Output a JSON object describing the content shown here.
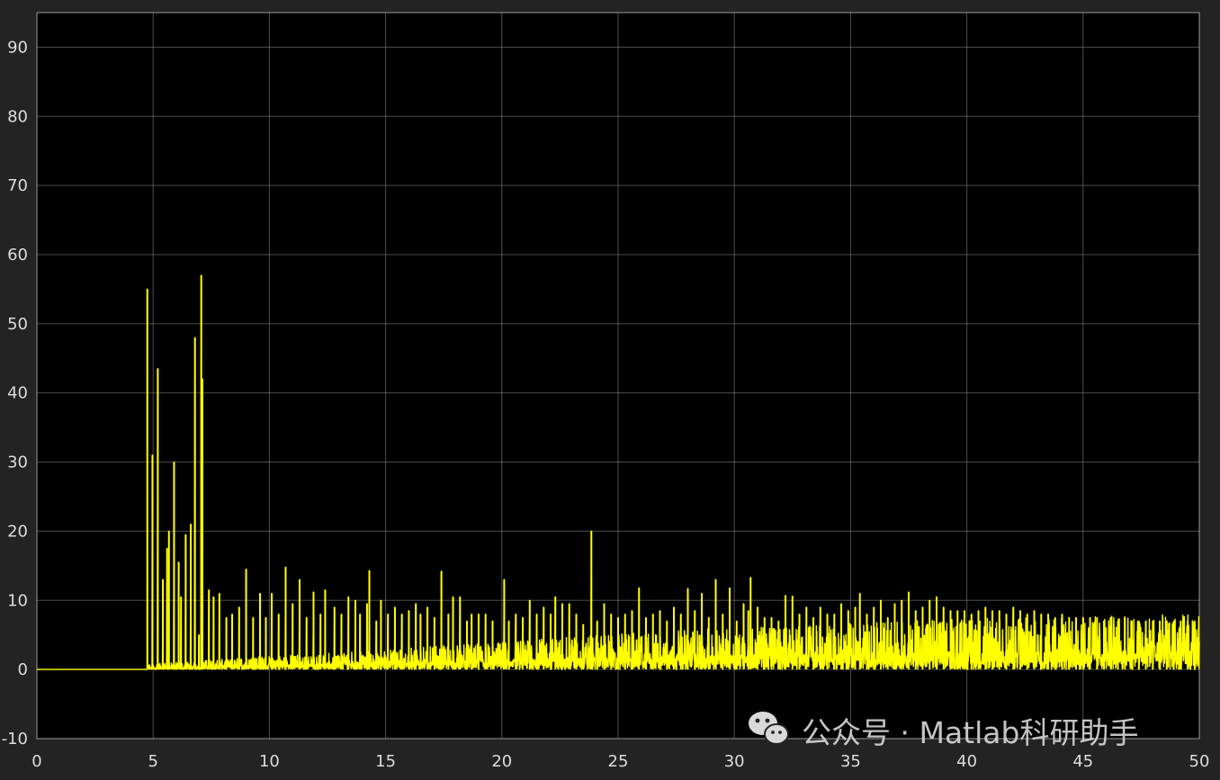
{
  "chart_data": {
    "type": "line",
    "title": "",
    "xlabel": "",
    "ylabel": "",
    "xlim": [
      0,
      50
    ],
    "ylim": [
      -10,
      95
    ],
    "x_ticks": [
      0,
      5,
      10,
      15,
      20,
      25,
      30,
      35,
      40,
      45,
      50
    ],
    "y_ticks": [
      -10,
      0,
      10,
      20,
      30,
      40,
      50,
      60,
      70,
      80,
      90
    ],
    "x_tick_labels": [
      "0",
      "5",
      "10",
      "15",
      "20",
      "25",
      "30",
      "35",
      "40",
      "45",
      "50"
    ],
    "y_tick_labels": [
      "-10",
      "0",
      "10",
      "20",
      "30",
      "40",
      "50",
      "60",
      "70",
      "80",
      "90"
    ],
    "grid": true,
    "background_color": "#000000",
    "figure_color": "#232323",
    "line_color": "#ffff00",
    "zero_before_x": 4.75,
    "peaks": [
      [
        4.75,
        55
      ],
      [
        4.97,
        31
      ],
      [
        5.2,
        43.5
      ],
      [
        5.42,
        13
      ],
      [
        5.6,
        17.5
      ],
      [
        5.68,
        20
      ],
      [
        5.9,
        30
      ],
      [
        6.1,
        15.5
      ],
      [
        6.2,
        10.5
      ],
      [
        6.4,
        19.5
      ],
      [
        6.62,
        21
      ],
      [
        6.8,
        48
      ],
      [
        6.97,
        5
      ],
      [
        7.07,
        57
      ],
      [
        7.12,
        42
      ],
      [
        7.4,
        11.5
      ],
      [
        7.6,
        10.5
      ],
      [
        7.85,
        11
      ],
      [
        8.15,
        7.5
      ],
      [
        8.4,
        8
      ],
      [
        8.7,
        9
      ],
      [
        9.0,
        14.5
      ],
      [
        9.3,
        7.5
      ],
      [
        9.6,
        11
      ],
      [
        9.85,
        7.5
      ],
      [
        10.1,
        11
      ],
      [
        10.4,
        8
      ],
      [
        10.7,
        14.8
      ],
      [
        11.0,
        9.5
      ],
      [
        11.3,
        13
      ],
      [
        11.6,
        7.5
      ],
      [
        11.9,
        11.2
      ],
      [
        12.2,
        8
      ],
      [
        12.4,
        11.5
      ],
      [
        12.8,
        9
      ],
      [
        13.1,
        8
      ],
      [
        13.4,
        10.5
      ],
      [
        13.7,
        10
      ],
      [
        13.9,
        8
      ],
      [
        14.2,
        9.5
      ],
      [
        14.3,
        14.3
      ],
      [
        14.6,
        7
      ],
      [
        14.8,
        10
      ],
      [
        15.1,
        8
      ],
      [
        15.4,
        9
      ],
      [
        15.7,
        8
      ],
      [
        16.0,
        8.5
      ],
      [
        16.3,
        9.5
      ],
      [
        16.5,
        8
      ],
      [
        16.8,
        9
      ],
      [
        17.1,
        7.5
      ],
      [
        17.4,
        14.2
      ],
      [
        17.7,
        8
      ],
      [
        17.9,
        10.5
      ],
      [
        18.2,
        10.5
      ],
      [
        18.5,
        7
      ],
      [
        18.7,
        8
      ],
      [
        19.0,
        8
      ],
      [
        19.3,
        8
      ],
      [
        19.6,
        7
      ],
      [
        20.1,
        13
      ],
      [
        20.3,
        7
      ],
      [
        20.6,
        8
      ],
      [
        20.9,
        7.5
      ],
      [
        21.2,
        10
      ],
      [
        21.5,
        8
      ],
      [
        21.8,
        9
      ],
      [
        22.1,
        8
      ],
      [
        22.3,
        10.5
      ],
      [
        22.6,
        9.5
      ],
      [
        22.9,
        9.5
      ],
      [
        23.2,
        8
      ],
      [
        23.5,
        6.5
      ],
      [
        23.85,
        20
      ],
      [
        24.1,
        7
      ],
      [
        24.4,
        9.5
      ],
      [
        24.7,
        8
      ],
      [
        25.0,
        7.5
      ],
      [
        25.3,
        8
      ],
      [
        25.6,
        8.5
      ],
      [
        25.9,
        11.8
      ],
      [
        26.2,
        7.5
      ],
      [
        26.5,
        8
      ],
      [
        26.8,
        8.5
      ],
      [
        27.1,
        7
      ],
      [
        27.4,
        9
      ],
      [
        27.7,
        8
      ],
      [
        28.0,
        11.7
      ],
      [
        28.3,
        8.5
      ],
      [
        28.6,
        11
      ],
      [
        28.9,
        7.5
      ],
      [
        29.2,
        13
      ],
      [
        29.5,
        8
      ],
      [
        29.8,
        11.8
      ],
      [
        30.1,
        7
      ],
      [
        30.4,
        9.5
      ],
      [
        30.6,
        8.5
      ],
      [
        30.7,
        13.3
      ],
      [
        31.0,
        9
      ],
      [
        31.3,
        7.5
      ],
      [
        31.6,
        7.5
      ],
      [
        31.9,
        7
      ],
      [
        32.2,
        10.7
      ],
      [
        32.5,
        10.6
      ],
      [
        32.8,
        8
      ],
      [
        33.1,
        9
      ],
      [
        33.4,
        7.5
      ],
      [
        33.7,
        9
      ],
      [
        34.0,
        8
      ],
      [
        34.3,
        8
      ],
      [
        34.6,
        9.5
      ],
      [
        34.9,
        8.5
      ],
      [
        35.2,
        9
      ],
      [
        35.4,
        11
      ],
      [
        35.7,
        8
      ],
      [
        36.0,
        9
      ],
      [
        36.3,
        10
      ],
      [
        36.6,
        7.5
      ],
      [
        36.9,
        9.5
      ],
      [
        37.2,
        10
      ],
      [
        37.5,
        11.2
      ],
      [
        37.8,
        8.5
      ],
      [
        38.1,
        9
      ],
      [
        38.4,
        10
      ],
      [
        38.7,
        10.5
      ],
      [
        39.0,
        9
      ],
      [
        39.3,
        8.5
      ],
      [
        39.6,
        8.5
      ],
      [
        39.9,
        8.5
      ],
      [
        40.2,
        8
      ],
      [
        40.5,
        8.5
      ],
      [
        40.8,
        9
      ],
      [
        41.1,
        8.5
      ],
      [
        41.4,
        8.5
      ],
      [
        41.7,
        8
      ],
      [
        42.0,
        9
      ],
      [
        42.3,
        8.5
      ],
      [
        42.6,
        8
      ],
      [
        42.9,
        8.5
      ],
      [
        43.2,
        8
      ],
      [
        43.5,
        8
      ],
      [
        43.8,
        7.5
      ],
      [
        44.1,
        8
      ],
      [
        44.4,
        7.5
      ],
      [
        44.7,
        7.5
      ],
      [
        45.0,
        7.5
      ],
      [
        45.3,
        7.5
      ],
      [
        45.6,
        7.5
      ],
      [
        45.9,
        7
      ],
      [
        46.2,
        7.5
      ],
      [
        46.5,
        7
      ],
      [
        46.8,
        7.5
      ],
      [
        47.1,
        7
      ],
      [
        47.4,
        7
      ],
      [
        47.7,
        7
      ],
      [
        48.0,
        7
      ],
      [
        48.3,
        7
      ],
      [
        48.6,
        7
      ],
      [
        48.9,
        7
      ],
      [
        49.2,
        7
      ],
      [
        49.5,
        7
      ],
      [
        49.8,
        7
      ]
    ],
    "noise_floor": [
      [
        5.0,
        0.5
      ],
      [
        10,
        1.2
      ],
      [
        15,
        1.8
      ],
      [
        20,
        2.5
      ],
      [
        25,
        3.2
      ],
      [
        30,
        3.8
      ],
      [
        35,
        4.2
      ],
      [
        40,
        4.6
      ],
      [
        45,
        4.8
      ],
      [
        50,
        5.0
      ]
    ]
  },
  "watermark": {
    "icon": "wechat-icon",
    "text": "公众号 · Matlab科研助手"
  }
}
